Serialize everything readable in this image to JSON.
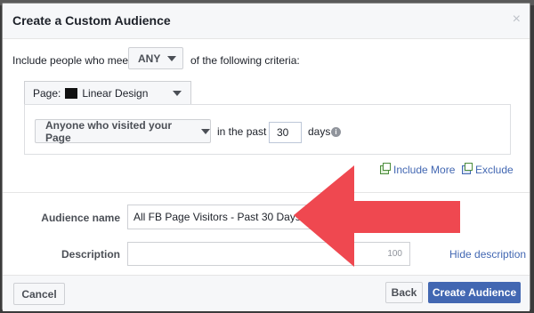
{
  "dialog": {
    "title": "Create a Custom Audience",
    "close_glyph": "×"
  },
  "criteria": {
    "prefix": "Include people who meet",
    "match_value": "ANY",
    "suffix": "of the following criteria:",
    "page_prefix": "Page:",
    "page_name": "Linear Design",
    "visitor_option": "Anyone who visited your Page",
    "in_the_past": "in the past",
    "days_value": "30",
    "days_label": "days",
    "info_glyph": "i"
  },
  "actions": {
    "include_more": "Include More",
    "exclude": "Exclude"
  },
  "form": {
    "audience_name_label": "Audience name",
    "audience_name_value": "All FB Page Visitors - Past 30 Days",
    "description_label": "Description",
    "description_value": "",
    "description_count": "100",
    "hide_description": "Hide description"
  },
  "footer": {
    "cancel_label": "Cancel",
    "back_label": "Back",
    "create_label": "Create Audience"
  },
  "colors": {
    "brand_blue": "#4267b2",
    "arrow_red": "#ef4850",
    "include_icon_green": "#4b8c3a"
  },
  "overlay": {
    "annotation": "red-arrow-pointing-left"
  }
}
